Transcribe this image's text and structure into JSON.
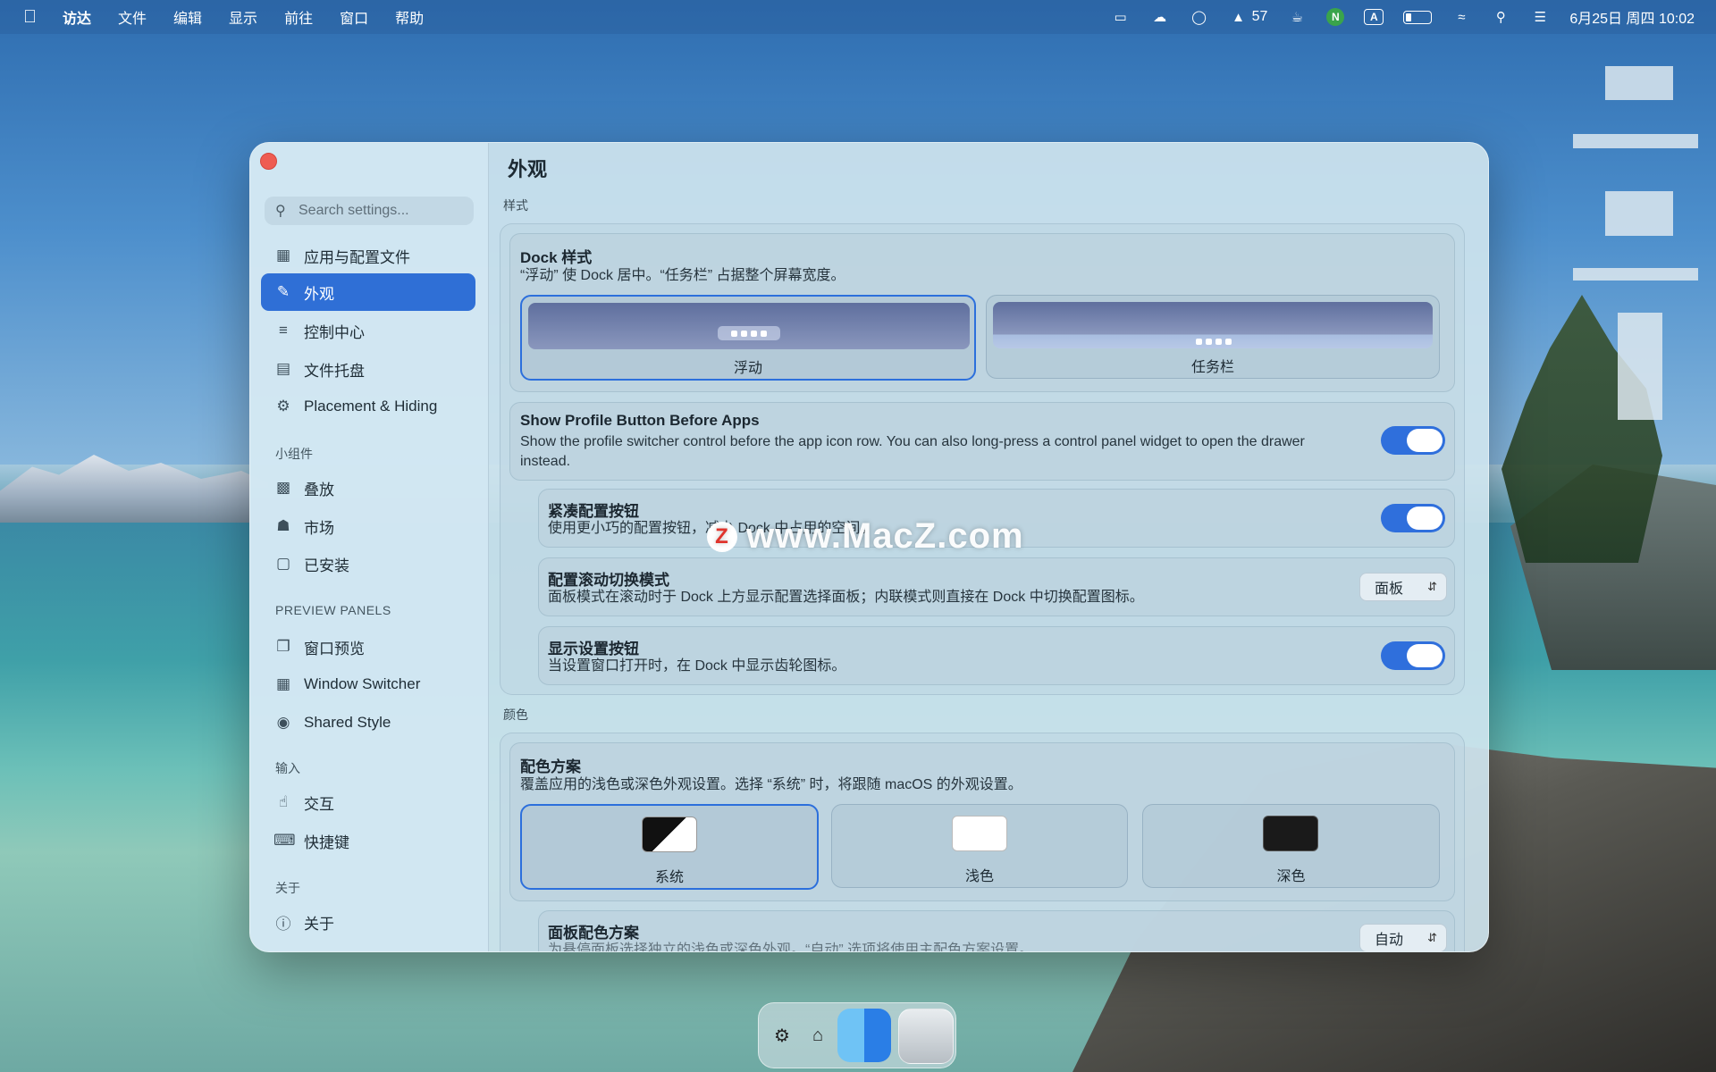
{
  "menubar": {
    "items": [
      "访达",
      "文件",
      "编辑",
      "显示",
      "前往",
      "窗口",
      "帮助"
    ],
    "status_count": "57",
    "n_badge": "N",
    "a_badge": "A",
    "datetime": "6月25日 周四  10:02"
  },
  "sidebar": {
    "search_placeholder": "Search settings...",
    "items_main": [
      "应用与配置文件",
      "外观",
      "控制中心",
      "文件托盘",
      "Placement & Hiding"
    ],
    "head_widgets": "小组件",
    "items_widgets": [
      "叠放",
      "市场",
      "已安装"
    ],
    "head_preview": "PREVIEW PANELS",
    "items_preview": [
      "窗口预览",
      "Window Switcher",
      "Shared Style"
    ],
    "head_input": "输入",
    "items_input": [
      "交互",
      "快捷键"
    ],
    "head_about": "关于",
    "items_about": [
      "关于"
    ]
  },
  "content": {
    "title": "外观",
    "section_style": "样式",
    "dock_style": {
      "title": "Dock 样式",
      "desc": "“浮动” 使 Dock 居中。“任务栏” 占据整个屏幕宽度。",
      "options": [
        "浮动",
        "任务栏"
      ],
      "selected": "浮动"
    },
    "profile_button": {
      "title": "Show Profile Button Before Apps",
      "desc": "Show the profile switcher control before the app icon row. You can also long-press a control panel widget to open the drawer instead.",
      "enabled": true
    },
    "compact": {
      "title": "紧凑配置按钮",
      "desc": "使用更小巧的配置按钮，减少 Dock 中占用的空间。",
      "enabled": true
    },
    "scroll_mode": {
      "title": "配置滚动切换模式",
      "desc": "面板模式在滚动时于 Dock 上方显示配置选择面板；内联模式则直接在 Dock 中切换配置图标。",
      "value": "面板"
    },
    "settings_button": {
      "title": "显示设置按钮",
      "desc": "当设置窗口打开时，在 Dock 中显示齿轮图标。",
      "enabled": true
    },
    "section_color": "颜色",
    "color_scheme": {
      "title": "配色方案",
      "desc": "覆盖应用的浅色或深色外观设置。选择 “系统” 时，将跟随 macOS 的外观设置。",
      "options": [
        "系统",
        "浅色",
        "深色"
      ],
      "selected": "系统"
    },
    "panel_scheme": {
      "title": "面板配色方案",
      "desc": "为悬停面板选择独立的浅色或深色外观。“自动” 选项将使用主配色方案设置。",
      "value": "自动"
    }
  },
  "watermark": "www.MacZ.com",
  "watermark_badge": "Z",
  "colors": {
    "accent": "#2f6fdc",
    "close": "#ee5c52"
  }
}
